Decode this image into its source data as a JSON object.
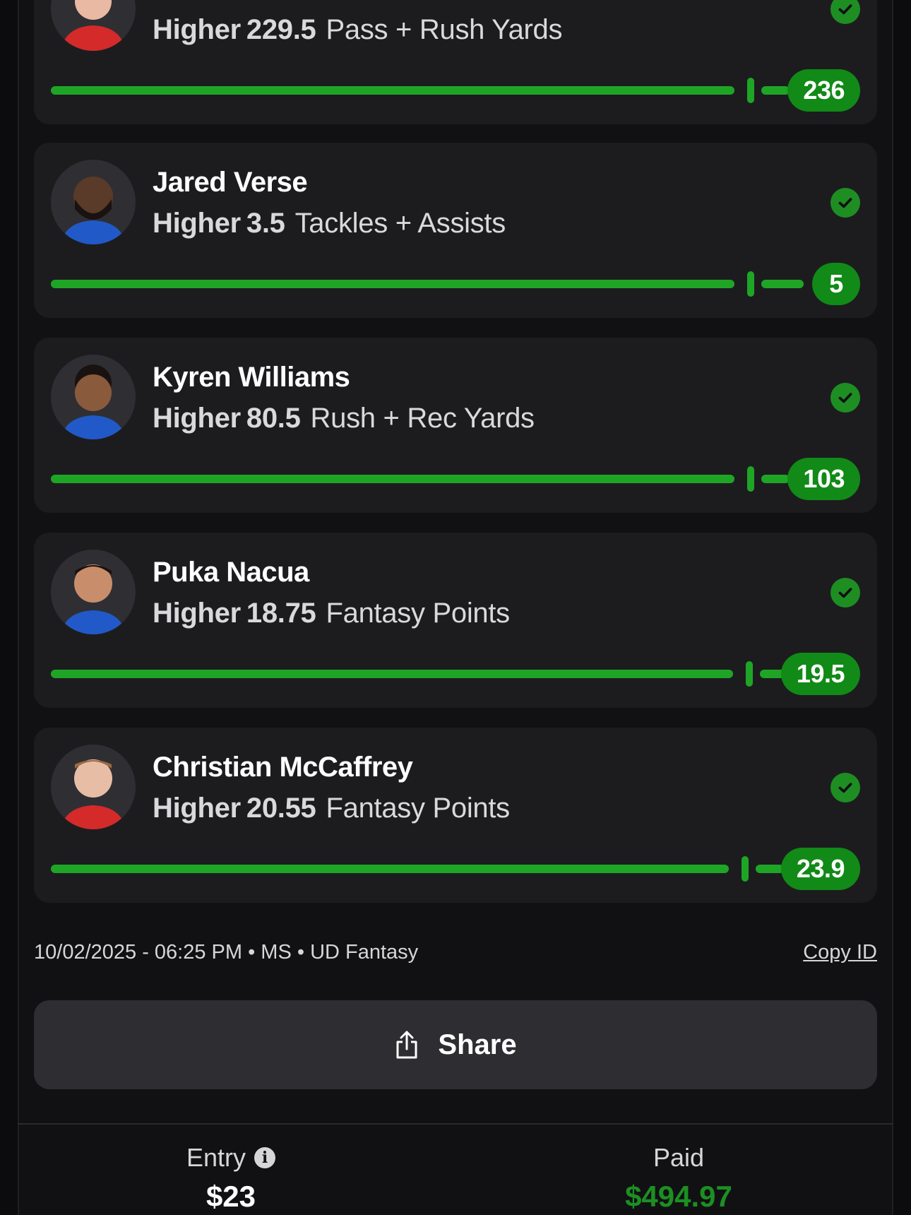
{
  "picks": [
    {
      "player": "",
      "direction": "Higher",
      "line": "229.5",
      "stat": "Pass + Rush Yards",
      "result": "236",
      "status": "won",
      "jersey_color": "#d42a2a"
    },
    {
      "player": "Jared Verse",
      "direction": "Higher",
      "line": "3.5",
      "stat": "Tackles + Assists",
      "result": "5",
      "status": "won",
      "jersey_color": "#2259c8"
    },
    {
      "player": "Kyren Williams",
      "direction": "Higher",
      "line": "80.5",
      "stat": "Rush + Rec Yards",
      "result": "103",
      "status": "won",
      "jersey_color": "#2259c8"
    },
    {
      "player": "Puka Nacua",
      "direction": "Higher",
      "line": "18.75",
      "stat": "Fantasy Points",
      "result": "19.5",
      "status": "won",
      "jersey_color": "#2259c8"
    },
    {
      "player": "Christian McCaffrey",
      "direction": "Higher",
      "line": "20.55",
      "stat": "Fantasy Points",
      "result": "23.9",
      "status": "won",
      "jersey_color": "#d42a2a"
    }
  ],
  "meta": {
    "info": "10/02/2025 - 06:25 PM • MS • UD Fantasy",
    "copy_id_label": "Copy ID"
  },
  "share": {
    "label": "Share",
    "icon": "share-icon"
  },
  "footer": {
    "entry_label": "Entry",
    "entry_value": "$23",
    "paid_label": "Paid",
    "paid_value": "$494.97",
    "info_icon": "info-icon"
  },
  "colors": {
    "accent_green": "#1fa526",
    "paid_green": "#1c8f22",
    "card_bg": "#1c1c1f",
    "page_bg": "#111113"
  }
}
